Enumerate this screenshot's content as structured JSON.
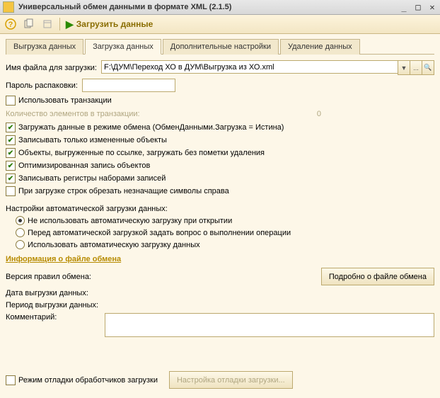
{
  "titlebar": {
    "title": "Универсальный обмен данными в формате XML (2.1.5)"
  },
  "toolbar": {
    "load_label": "Загрузить данные"
  },
  "tabs": [
    "Выгрузка данных",
    "Загрузка данных",
    "Дополнительные настройки",
    "Удаление данных"
  ],
  "form": {
    "filename_label": "Имя файла для загрузки:",
    "filename_value": "F:\\ДУМ\\Переход ХО в ДУМ\\Выгрузка из ХО.xml",
    "password_label": "Пароль распаковки:",
    "use_transaction": "Использовать транзакции",
    "txn_count_label": "Количество элементов в транзакции:",
    "txn_count_value": "0",
    "chk1": "Загружать данные в режиме обмена (ОбменДанными.Загрузка = Истина)",
    "chk2": "Записывать только измененные объекты",
    "chk3": "Объекты, выгруженные по ссылке, загружать без пометки удаления",
    "chk4": "Оптимизированная запись объектов",
    "chk5": "Записывать регистры наборами записей",
    "chk6": "При загрузке строк обрезать незначащие символы справа",
    "autoload_label": "Настройки автоматической загрузки данных:",
    "radio": [
      "Не использовать автоматическую загрузку при открытии",
      "Перед автоматической загрузкой задать вопрос о выполнении операции",
      "Использовать автоматическую загрузку данных"
    ]
  },
  "info": {
    "title": "Информация о файле обмена",
    "rules_version": "Версия правил обмена:",
    "details_btn": "Подробно о файле обмена",
    "export_date": "Дата выгрузки данных:",
    "export_period": "Период выгрузки данных:",
    "comment_label": "Комментарий:"
  },
  "footer": {
    "debug_label": "Режим отладки обработчиков загрузки",
    "debug_btn": "Настройка отладки загрузки..."
  }
}
